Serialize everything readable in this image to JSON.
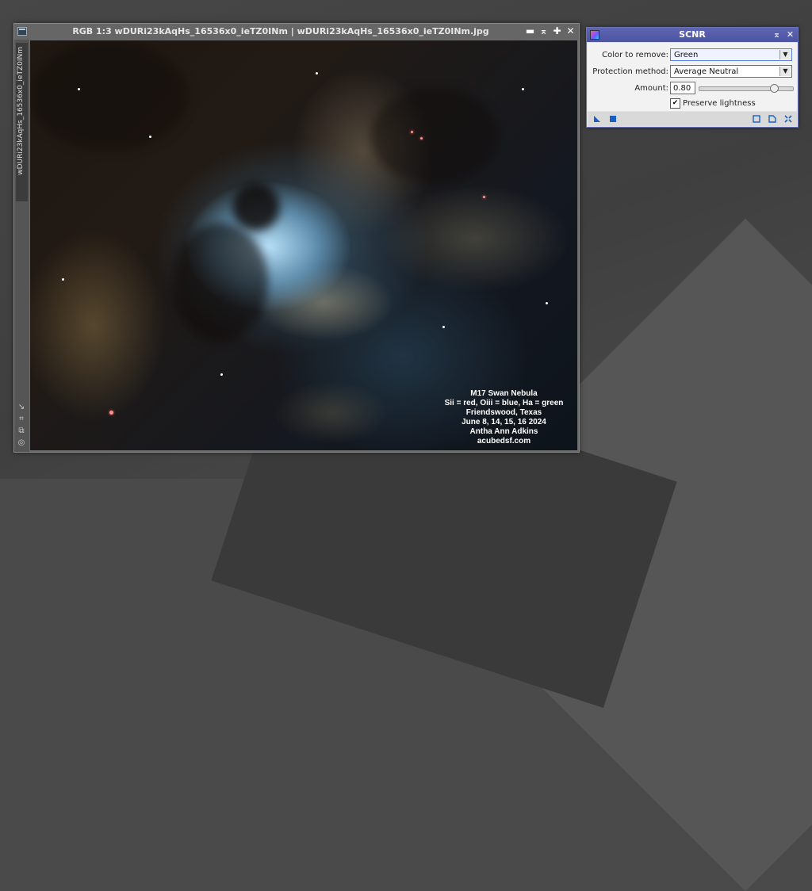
{
  "image_window": {
    "title": "RGB 1:3 wDURi23kAqHs_16536x0_ieTZ0INm | wDURi23kAqHs_16536x0_ieTZ0INm.jpg",
    "side_label": "wDURi23kAqHs_16536x0_ieTZ0INm",
    "buttons": {
      "shade": "▬",
      "minimize": "⌅",
      "maximize": "✚",
      "close": "✕"
    },
    "side_icons": [
      "↘",
      "⌗",
      "⧉",
      "◎"
    ],
    "caption": [
      "M17 Swan Nebula",
      "Sii = red, Oiii = blue, Ha = green",
      "Friendswood, Texas",
      "June 8, 14, 15, 16 2024",
      "Antha Ann Adkins",
      "acubedsf.com"
    ]
  },
  "scnr": {
    "title": "SCNR",
    "buttons": {
      "shade": "⌅",
      "close": "✕"
    },
    "color_to_remove": {
      "label": "Color to remove:",
      "value": "Green"
    },
    "protection_method": {
      "label": "Protection method:",
      "value": "Average Neutral"
    },
    "amount": {
      "label": "Amount:",
      "value": "0.80",
      "fraction": 0.8
    },
    "preserve_lightness": {
      "label": "Preserve lightness",
      "checked": true,
      "mark": "✔"
    },
    "accent_color": "#5e66b3",
    "icon_color": "#1d5fbf"
  }
}
